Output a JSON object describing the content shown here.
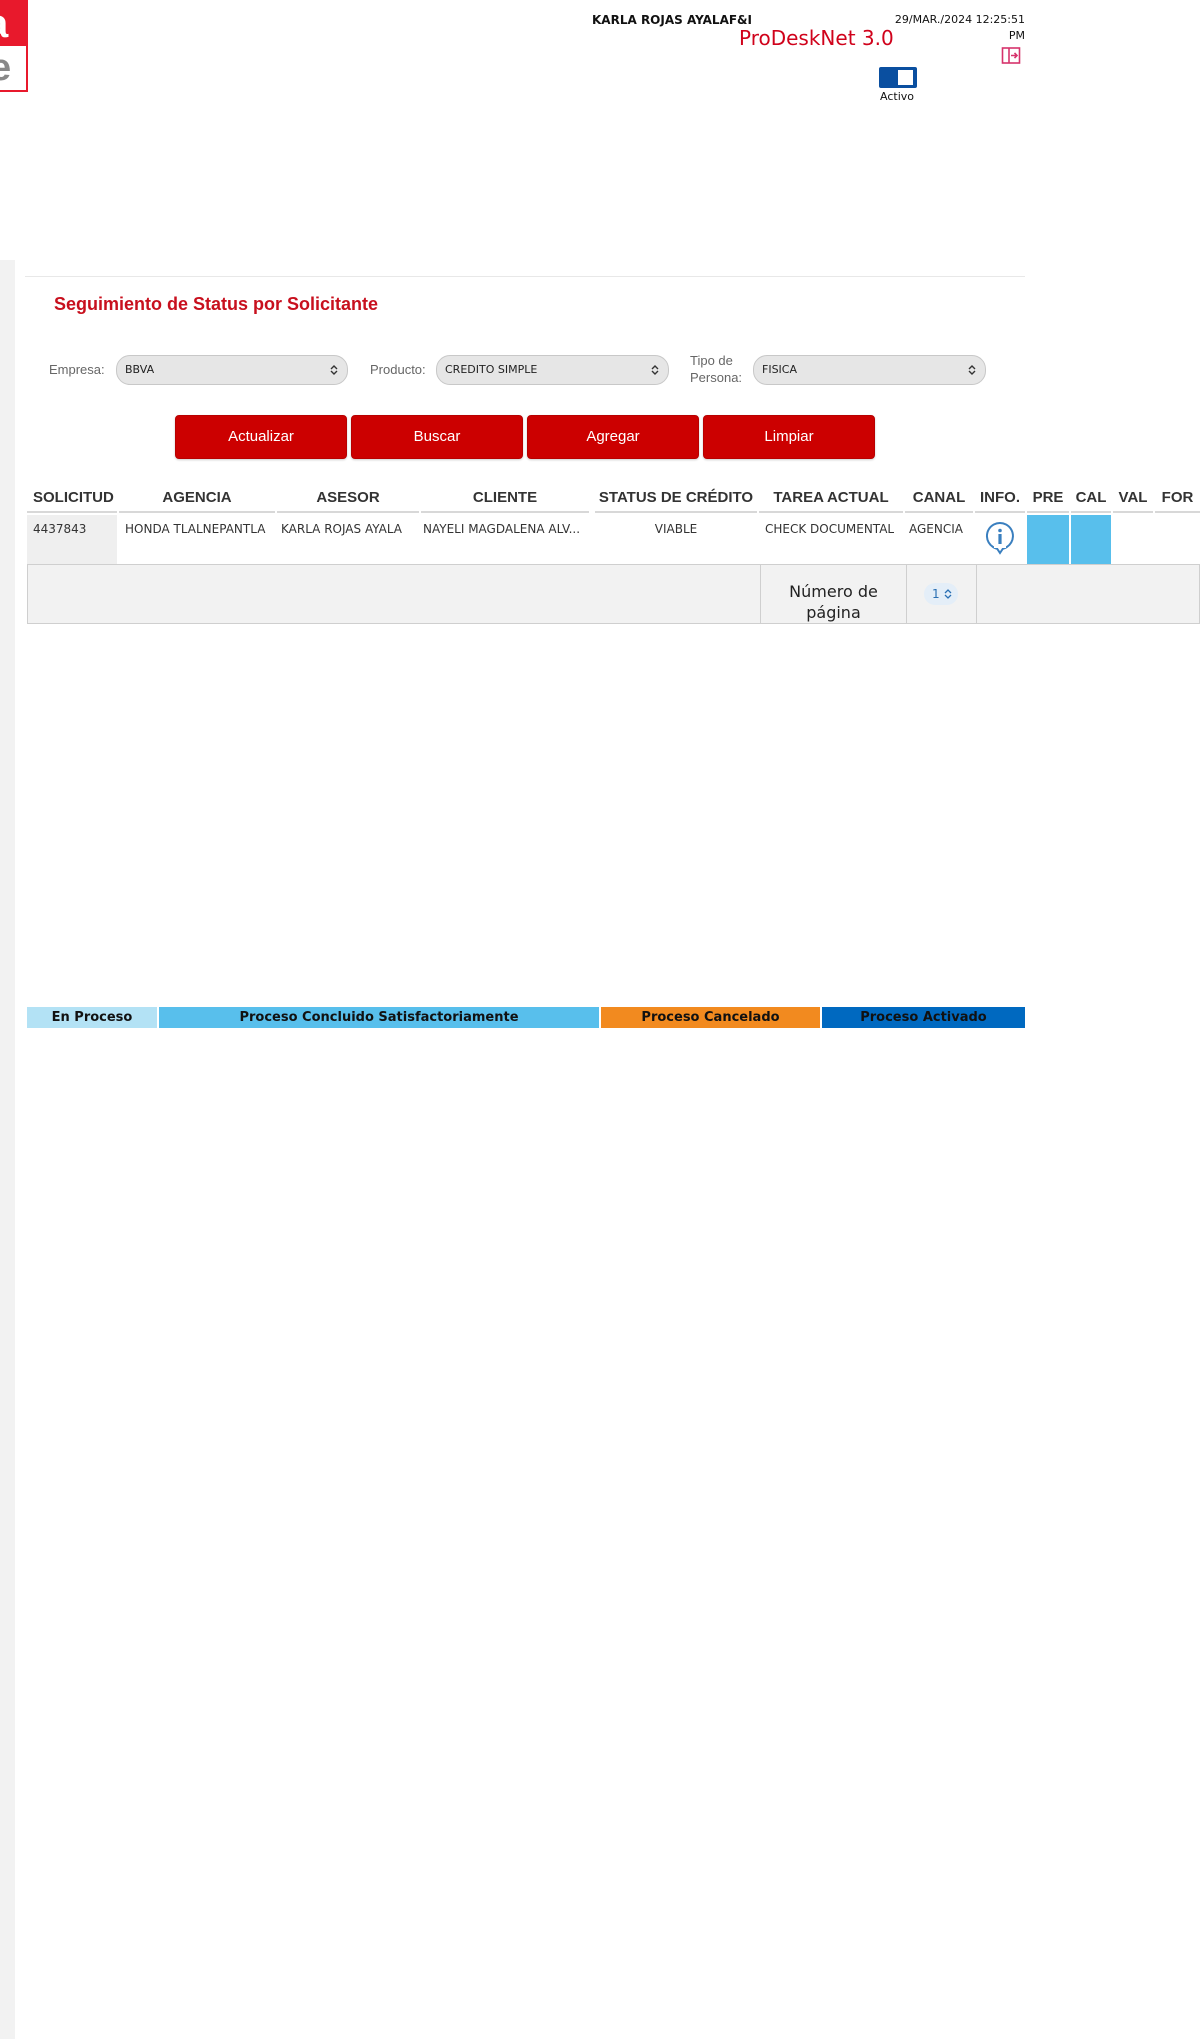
{
  "logo": {
    "top_fragment": "a",
    "bottom_fragment": "e"
  },
  "header": {
    "user_name": "KARLA ROJAS AYALAF&I",
    "date": "29/MAR./2024 12:25:51",
    "time_suffix": "PM",
    "app_title": "ProDeskNet 3.0",
    "toggle_label": "Activo",
    "toggle_on": true
  },
  "page": {
    "title": "Seguimiento de Status por Solicitante"
  },
  "filters": {
    "empresa_label": "Empresa:",
    "empresa_value": "BBVA",
    "producto_label": "Producto:",
    "producto_value": "CREDITO SIMPLE",
    "tipo_label_1": "Tipo de",
    "tipo_label_2": "Persona:",
    "tipo_value": "FISICA"
  },
  "buttons": {
    "actualizar": "Actualizar",
    "buscar": "Buscar",
    "agregar": "Agregar",
    "limpiar": "Limpiar"
  },
  "table": {
    "headers": [
      "SOLICITUD",
      "AGENCIA",
      "ASESOR",
      "CLIENTE",
      "STATUS DE CRÉDITO",
      "TAREA ACTUAL",
      "CANAL",
      "INFO.",
      "PRE",
      "CAL",
      "VAL",
      "FOR"
    ],
    "rows": [
      {
        "solicitud": "4437843",
        "agencia": "HONDA TLALNEPANTLA",
        "asesor": "KARLA ROJAS AYALA",
        "cliente": "NAYELI MAGDALENA ALV...",
        "status": "VIABLE",
        "tarea": "CHECK DOCUMENTAL",
        "canal": "AGENCIA"
      }
    ],
    "pagination_label": "Número de página",
    "page_number": "1"
  },
  "legend": [
    {
      "label": "En Proceso",
      "color": "#b3e2f5"
    },
    {
      "label": "Proceso Concluido Satisfactoriamente",
      "color": "#58bfec"
    },
    {
      "label": "Proceso Cancelado",
      "color": "#f28a1f"
    },
    {
      "label": "Proceso Activado",
      "color": "#0069c0"
    }
  ],
  "colors": {
    "brand_red": "#cc0000",
    "title_red": "#c8101e",
    "stage_done": "#58bfec"
  }
}
